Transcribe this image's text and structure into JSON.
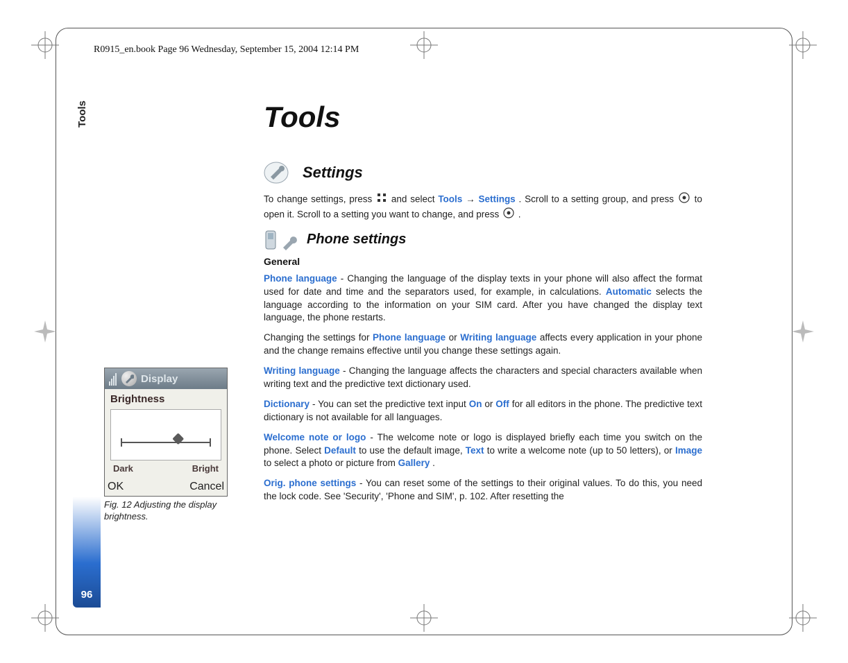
{
  "header_line": "R0915_en.book  Page 96  Wednesday, September 15, 2004  12:14 PM",
  "side_tab": "Tools",
  "page_number": "96",
  "title": "Tools",
  "h2_settings": "Settings",
  "settings_para_1a": "To change settings, press ",
  "settings_para_1b": " and select ",
  "settings_link_tools": "Tools",
  "settings_arrow": "→ ",
  "settings_link_settings": "Settings",
  "settings_para_1c": ". Scroll to a setting group, and press ",
  "settings_para_1d": " to open it. Scroll to a setting you want to change, and press ",
  "settings_para_1e": " .",
  "h3_phone_settings": "Phone settings",
  "h4_general": "General",
  "p1_link1": "Phone language",
  "p1_a": " - Changing the language of the display texts in your phone will also affect the format used for date and time and the separators used, for example, in calculations. ",
  "p1_link2": "Automatic",
  "p1_b": " selects the language according to the information on your SIM card. After you have changed the display text language, the phone restarts.",
  "p2_a": "Changing the settings for ",
  "p2_link1": "Phone language",
  "p2_b": " or ",
  "p2_link2": "Writing language",
  "p2_c": " affects every application in your phone and the change remains effective until you change these settings again.",
  "p3_link1": "Writing language",
  "p3_a": " - Changing the language affects the characters and special characters available when writing text and the predictive text dictionary used.",
  "p4_link1": "Dictionary",
  "p4_a": " - You can set the predictive text input ",
  "p4_link2": "On",
  "p4_b": " or ",
  "p4_link3": "Off",
  "p4_c": " for all editors in the phone. The predictive text dictionary is not available for all languages.",
  "p5_link1": "Welcome note or logo",
  "p5_a": " - The welcome note or logo is displayed briefly each time you switch on the phone. Select ",
  "p5_link2": "Default",
  "p5_b": " to use the default image, ",
  "p5_link3": "Text",
  "p5_c": " to write a welcome note (up to 50 letters), or ",
  "p5_link4": "Image",
  "p5_d": " to select a photo or picture from ",
  "p5_link5": "Gallery",
  "p5_e": ".",
  "p6_link1": "Orig. phone settings",
  "p6_a": " - You can reset some of the settings to their original values. To do this, you need the lock code. See 'Security', 'Phone and SIM', p. 102. After resetting the",
  "figure": {
    "screen_title": "Display",
    "section_title": "Brightness",
    "slider_left": "Dark",
    "slider_right": "Bright",
    "softkey_left": "OK",
    "softkey_right": "Cancel",
    "caption": "Fig. 12 Adjusting the display brightness."
  }
}
